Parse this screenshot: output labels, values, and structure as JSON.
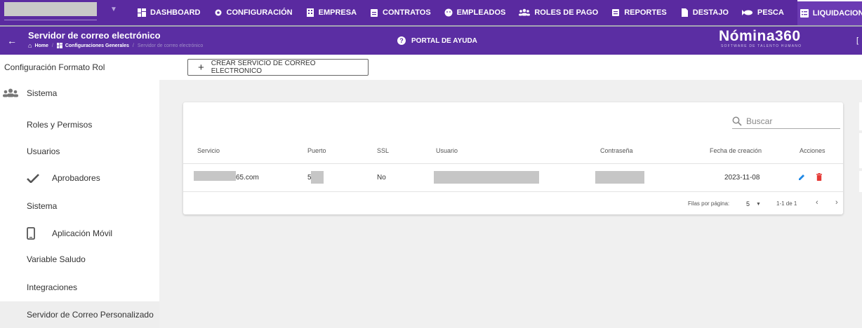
{
  "topnav": {
    "items": [
      {
        "label": "DASHBOARD",
        "icon": "dashboard-icon"
      },
      {
        "label": "CONFIGURACIÓN",
        "icon": "gear-icon"
      },
      {
        "label": "EMPRESA",
        "icon": "building-icon"
      },
      {
        "label": "CONTRATOS",
        "icon": "clipboard-icon"
      },
      {
        "label": "EMPLEADOS",
        "icon": "face-icon"
      },
      {
        "label": "ROLES DE PAGO",
        "icon": "people-icon"
      },
      {
        "label": "REPORTES",
        "icon": "report-icon"
      },
      {
        "label": "DESTAJO",
        "icon": "document-icon"
      },
      {
        "label": "PESCA",
        "icon": "fish-icon"
      },
      {
        "label": "LIQUIDACIONES",
        "icon": "list-icon"
      }
    ]
  },
  "subheader": {
    "title": "Servidor de correo electrónico",
    "breadcrumb": [
      "Home",
      "Configuraciones Generales",
      "Servidor de correo electrónico"
    ],
    "help": "PORTAL DE AYUDA",
    "logo": "Nómina360",
    "logo_sub": "SOFTWARE DE TALENTO HUMANO",
    "edge": "["
  },
  "sidebar": {
    "items": [
      {
        "label": "Configuración Formato Rol"
      },
      {
        "label": "Sistema",
        "icon": "people-icon"
      },
      {
        "label": "Roles y Permisos"
      },
      {
        "label": "Usuarios"
      },
      {
        "label": "Aprobadores",
        "icon": "check-icon"
      },
      {
        "label": "Sistema"
      },
      {
        "label": "Aplicación Móvil",
        "icon": "phone-icon"
      },
      {
        "label": "Variable Saludo"
      },
      {
        "label": "Integraciones"
      },
      {
        "label": "Servidor de Correo Personalizado"
      }
    ]
  },
  "main": {
    "create_label": "CREAR SERVICIO DE CORREO ELECTRONICO",
    "search_placeholder": "Buscar",
    "table": {
      "headers": [
        "Servicio",
        "Puerto",
        "SSL",
        "Usuario",
        "Contraseña",
        "Fecha de creación",
        "Acciones"
      ],
      "rows": [
        {
          "servicio": "65.com",
          "puerto": "5",
          "ssl": "No",
          "fecha": "2023-11-08"
        }
      ]
    },
    "pagination": {
      "rows_label": "Filas por página:",
      "rows_value": "5",
      "range": "1-1 de 1"
    }
  },
  "colors": {
    "nav_bg": "#5a2aa0",
    "delete": "#e53935",
    "edit": "#1e88e5"
  }
}
